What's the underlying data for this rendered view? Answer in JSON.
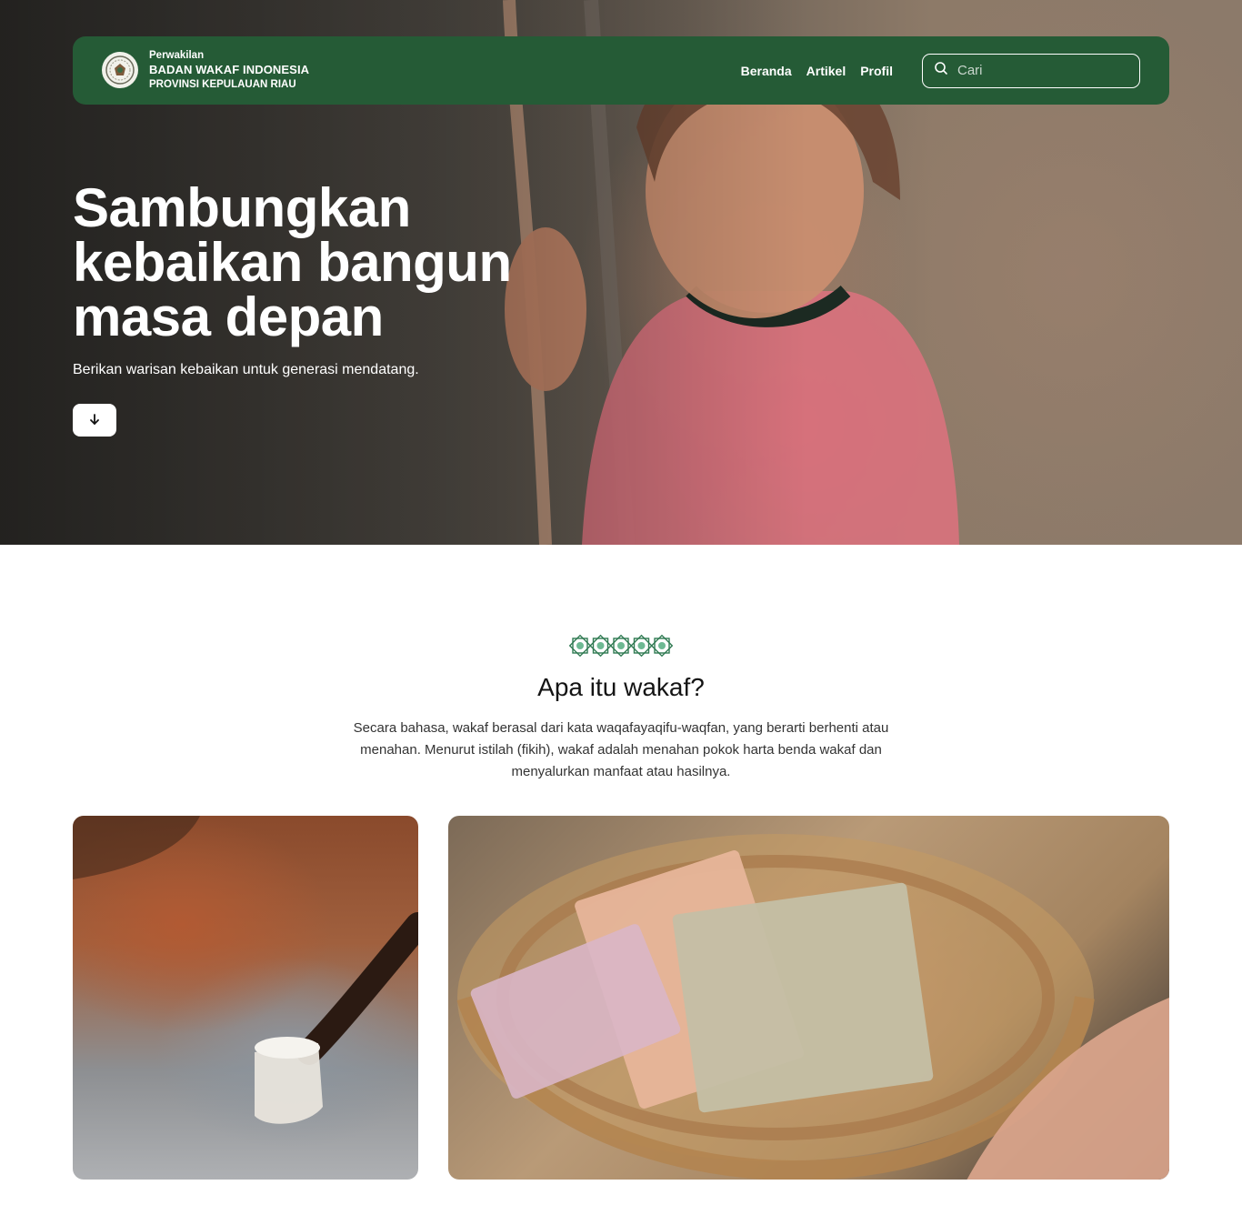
{
  "navbar": {
    "brand_small": "Perwakilan",
    "brand_main": "BADAN WAKAF INDONESIA",
    "brand_sub": "PROVINSI KEPULAUAN RIAU",
    "links": [
      {
        "label": "Beranda"
      },
      {
        "label": "Artikel"
      },
      {
        "label": "Profil"
      }
    ],
    "search_placeholder": "Cari",
    "color": "#255b36"
  },
  "hero": {
    "title": "Sambungkan kebaikan bangun masa depan",
    "subtitle": "Berikan warisan kebaikan untuk generasi mendatang.",
    "scroll_icon": "arrow-down-icon"
  },
  "about": {
    "ornament_icon": "islamic-star-ornament-icon",
    "title": "Apa itu wakaf?",
    "text": "Secara bahasa, wakaf berasal dari kata waqafayaqifu-waqfan, yang berarti berhenti atau menahan. Menurut istilah (fikih), wakaf adalah menahan pokok harta benda wakaf dan menyalurkan manfaat atau hasilnya."
  },
  "gallery": {
    "images": [
      {
        "name": "water-cup-photo"
      },
      {
        "name": "money-basket-photo"
      }
    ]
  }
}
